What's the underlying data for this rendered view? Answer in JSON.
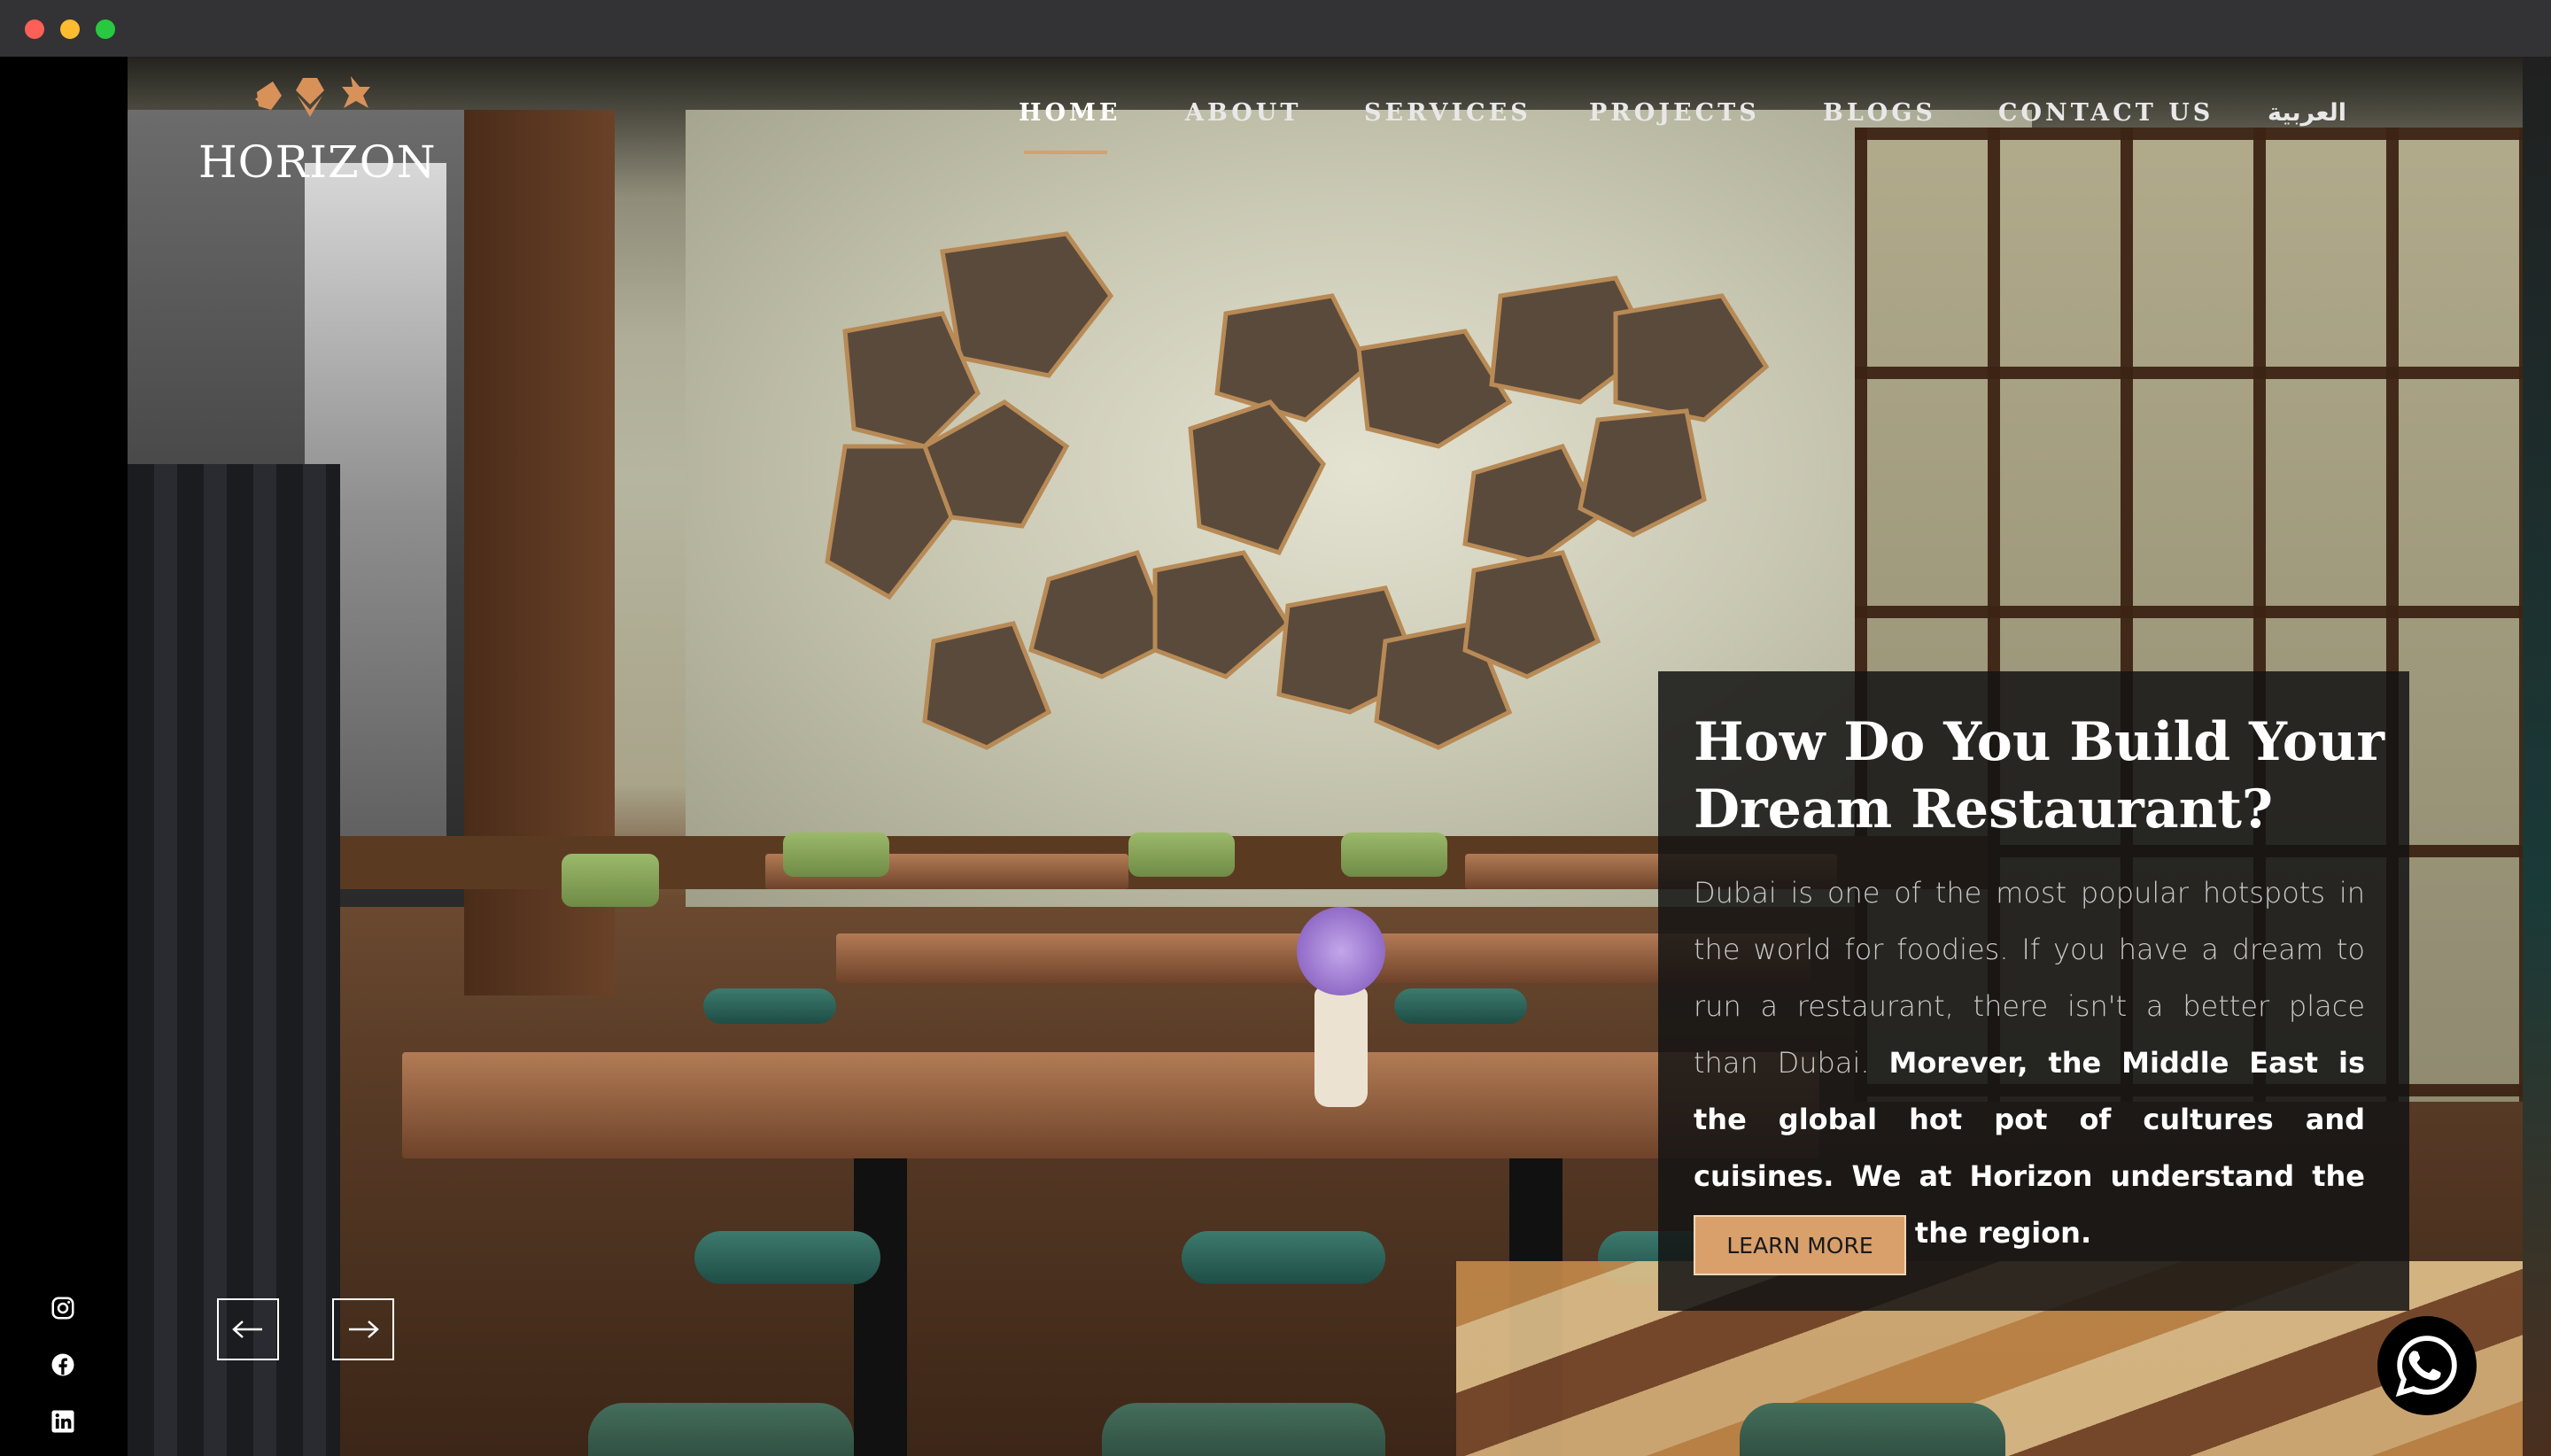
{
  "brand": {
    "name": "HORIZON",
    "accent_color": "#d9a06c"
  },
  "nav": {
    "items": [
      {
        "label": "HOME",
        "active": true
      },
      {
        "label": "ABOUT",
        "active": false
      },
      {
        "label": "SERVICES",
        "active": false
      },
      {
        "label": "PROJECTS",
        "active": false
      },
      {
        "label": "BLOGS",
        "active": false
      },
      {
        "label": "CONTACT US",
        "active": false
      },
      {
        "label": "العربية",
        "active": false
      }
    ]
  },
  "hero": {
    "title": "How Do You Build Your Dream Restaurant?",
    "body_light": "Dubai is one of the most popular hotspots in the world for foodies. If you have a dream to run a restaurant, there isn't a better place than Dubai.",
    "body_bold": "Morever, the Middle East is the global hot pot of cultures and cuisines. We at Horizon understand the taste buds of the region.",
    "cta_label": "LEARN MORE"
  },
  "slider": {
    "prev_icon": "arrow-left-icon",
    "next_icon": "arrow-right-icon"
  },
  "social": [
    {
      "icon": "instagram-icon"
    },
    {
      "icon": "facebook-icon"
    },
    {
      "icon": "linkedin-icon"
    }
  ],
  "whatsapp": {
    "icon": "whatsapp-icon"
  }
}
